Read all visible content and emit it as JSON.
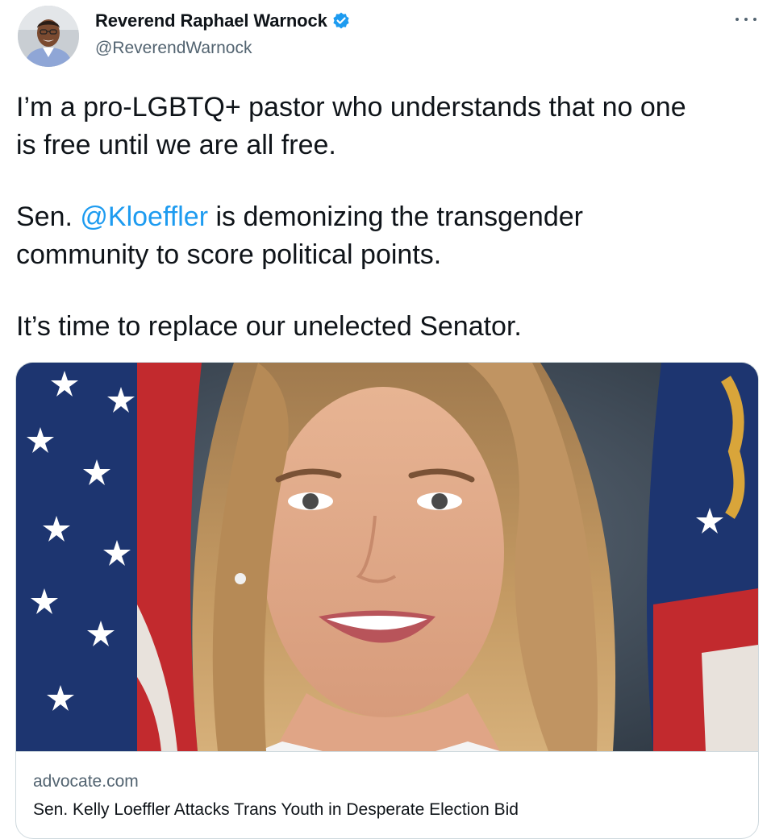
{
  "author": {
    "display_name": "Reverend Raphael Warnock",
    "handle": "@ReverendWarnock",
    "verified": true,
    "avatar": "profile-photo"
  },
  "tweet": {
    "line1": "I’m a pro-LGBTQ+ pastor who understands that no one",
    "line2": "is free until we are all free.",
    "line3_prefix": "Sen. ",
    "mention": "@Kloeffler",
    "line3_suffix": " is demonizing the transgender",
    "line4": "community to score political points.",
    "line5": "It’s time to replace our unelected Senator."
  },
  "link_card": {
    "image": "portrait-with-flags",
    "domain": "advocate.com",
    "title": "Sen. Kelly Loeffler Attacks Trans Youth in Desperate Election Bid"
  },
  "icons": {
    "verified": "verified-badge-icon",
    "more": "more-options-icon"
  },
  "colors": {
    "text": "#0f1419",
    "secondary": "#536471",
    "link": "#1d9bf0",
    "verified": "#1d9bf0",
    "border": "#cfd9de"
  }
}
